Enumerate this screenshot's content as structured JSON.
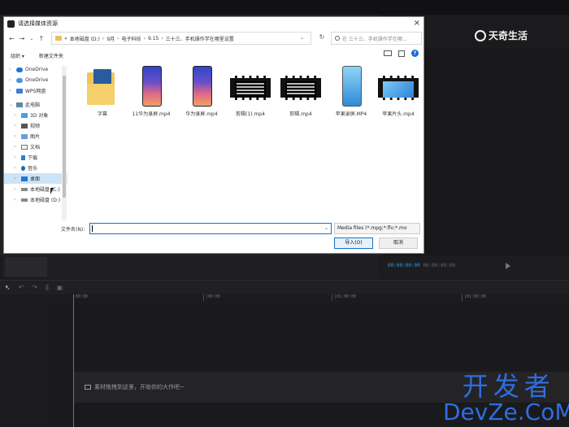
{
  "logo": {
    "text": "天奇生活"
  },
  "preview": {
    "current_time": "00:00:00:00",
    "total_time": "00:00:00:00"
  },
  "timeline": {
    "ticks": [
      "00:00",
      "|00:00",
      "|01:00:00",
      "|01:00:00"
    ],
    "track_hint": "素材拖拽到这里，开始你的大作吧~"
  },
  "watermark": {
    "cn": "开发者",
    "en": "DevZe.CoM"
  },
  "dialog": {
    "title": "请选择媒体资源",
    "close": "×",
    "breadcrumb": [
      "«",
      "本地磁盘 (D:)",
      "9月",
      "电子科技",
      "9.15",
      "三十三、手机操作学在哪里设置"
    ],
    "search_placeholder": "在 三十三、手机操作学在哪...",
    "toolbar": {
      "organize": "组织 ▾",
      "new_folder": "新建文件夹"
    },
    "nav_items": [
      {
        "label": "OneDrive",
        "icon": "cloud-icon",
        "chev": "›"
      },
      {
        "label": "OneDrive",
        "icon": "cloud-icon",
        "chev": "›"
      },
      {
        "label": "WPS网盘",
        "icon": "wps-icon",
        "chev": "›"
      },
      {
        "label": "此电脑",
        "icon": "pc-icon",
        "chev": "⌄"
      },
      {
        "label": "3D 对象",
        "icon": "objects-3d-icon",
        "chev": "›"
      },
      {
        "label": "视频",
        "icon": "video-icon",
        "chev": "›"
      },
      {
        "label": "图片",
        "icon": "picture-icon",
        "chev": "›"
      },
      {
        "label": "文档",
        "icon": "document-icon",
        "chev": "›"
      },
      {
        "label": "下载",
        "icon": "download-icon",
        "chev": "›"
      },
      {
        "label": "音乐",
        "icon": "music-icon",
        "chev": "›"
      },
      {
        "label": "桌面",
        "icon": "desktop-icon",
        "chev": "›",
        "selected": true
      },
      {
        "label": "本地磁盘 (C:)",
        "icon": "drive-icon",
        "chev": "›"
      },
      {
        "label": "本地磁盘 (D:)",
        "icon": "drive-icon",
        "chev": "›"
      }
    ],
    "files": [
      {
        "name": "字幕",
        "kind": "folder"
      },
      {
        "name": "11华为录屏.mp4",
        "kind": "phone"
      },
      {
        "name": "华为录屏.mp4",
        "kind": "phone"
      },
      {
        "name": "剪辑(1).mp4",
        "kind": "film"
      },
      {
        "name": "剪辑.mp4",
        "kind": "film"
      },
      {
        "name": "苹果录屏.MP4",
        "kind": "phone-ios"
      },
      {
        "name": "苹果片头.mp4",
        "kind": "film-blue"
      }
    ],
    "filename_label": "文件名(N):",
    "filename_value": "",
    "filetype": "Media files (*.mpg;*.flv;*.mo",
    "open_button": "导入(O)",
    "cancel_button": "取消"
  }
}
